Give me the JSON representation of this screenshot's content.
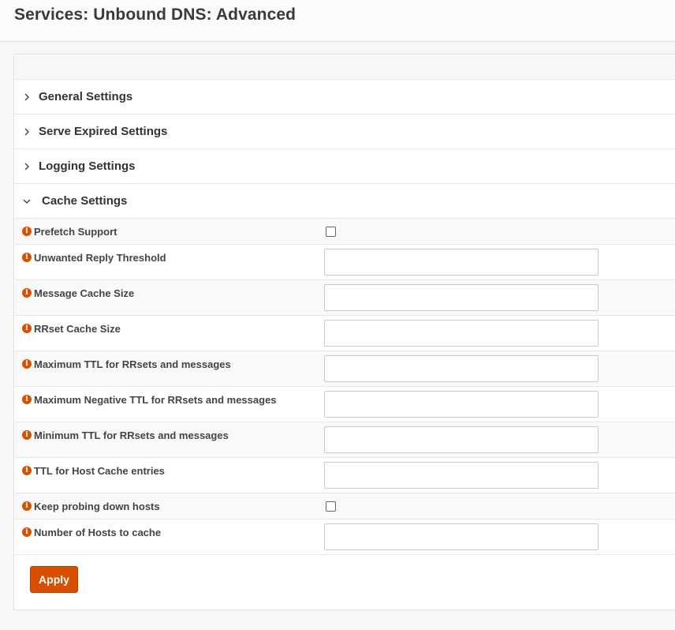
{
  "page": {
    "title": "Services: Unbound DNS: Advanced"
  },
  "sections": [
    {
      "label": "General Settings",
      "expanded": false
    },
    {
      "label": "Serve Expired Settings",
      "expanded": false
    },
    {
      "label": "Logging Settings",
      "expanded": false
    },
    {
      "label": "Cache Settings",
      "expanded": true
    }
  ],
  "cache_fields": {
    "prefetch_support": {
      "label": "Prefetch Support",
      "type": "checkbox",
      "checked": false
    },
    "unwanted_reply_threshold": {
      "label": "Unwanted Reply Threshold",
      "type": "text",
      "value": ""
    },
    "message_cache_size": {
      "label": "Message Cache Size",
      "type": "text",
      "value": ""
    },
    "rrset_cache_size": {
      "label": "RRset Cache Size",
      "type": "text",
      "value": ""
    },
    "max_ttl": {
      "label": "Maximum TTL for RRsets and messages",
      "type": "text",
      "value": ""
    },
    "max_negative_ttl": {
      "label": "Maximum Negative TTL for RRsets and messages",
      "type": "text",
      "value": ""
    },
    "min_ttl": {
      "label": "Minimum TTL for RRsets and messages",
      "type": "text",
      "value": ""
    },
    "host_cache_ttl": {
      "label": "TTL for Host Cache entries",
      "type": "text",
      "value": ""
    },
    "keep_probing": {
      "label": "Keep probing down hosts",
      "type": "checkbox",
      "checked": false
    },
    "hosts_to_cache": {
      "label": "Number of Hosts to cache",
      "type": "text",
      "value": ""
    }
  },
  "icons": {
    "info": "info-circle-icon",
    "collapsed": "chevron-right-icon",
    "expanded": "chevron-down-icon"
  },
  "info_glyph": "i",
  "buttons": {
    "apply": "Apply"
  },
  "colors": {
    "accent": "#d94f00",
    "info_icon": "#d94f00"
  }
}
